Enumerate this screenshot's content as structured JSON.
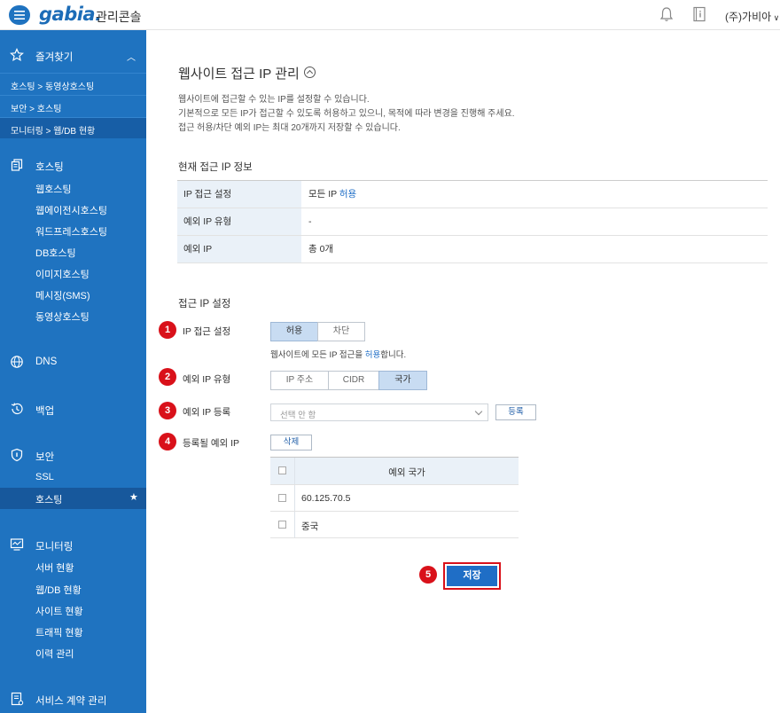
{
  "header": {
    "logo": "gabia.",
    "console_title": "관리콘솔",
    "company": "(주)가비아"
  },
  "sidebar": {
    "favorites": {
      "label": "즐겨찾기",
      "items": [
        "호스팅 > 동영상호스팅",
        "보안 > 호스팅",
        "모니터링 > 웹/DB 현황"
      ]
    },
    "hosting": {
      "label": "호스팅",
      "items": [
        "웹호스팅",
        "웹에이전시호스팅",
        "워드프레스호스팅",
        "DB호스팅",
        "이미지호스팅",
        "메시징(SMS)",
        "동영상호스팅"
      ]
    },
    "dns": {
      "label": "DNS"
    },
    "backup": {
      "label": "백업"
    },
    "security": {
      "label": "보안",
      "items": [
        "SSL"
      ],
      "active_item": "호스팅"
    },
    "monitoring": {
      "label": "모니터링",
      "items": [
        "서버 현황",
        "웹/DB 현황",
        "사이트 현황",
        "트래픽 현황",
        "이력 관리"
      ]
    },
    "contract": {
      "label": "서비스 계약 관리"
    }
  },
  "main": {
    "title": "웹사이트 접근 IP 관리",
    "description": [
      "웹사이트에 접근할 수 있는 IP를 설정할 수 있습니다.",
      "기본적으로 모든 IP가 접근할 수 있도록 허용하고 있으니, 목적에 따라 변경을 진행해 주세요.",
      "접근 허용/차단 예외 IP는 최대 20개까지 저장할 수 있습니다."
    ],
    "current_info": {
      "title": "현재 접근 IP 정보",
      "rows": [
        {
          "key": "IP 접근 설정",
          "value_prefix": "모든 IP ",
          "value_highlight": "허용"
        },
        {
          "key": "예외 IP 유형",
          "value_prefix": "-",
          "value_highlight": ""
        },
        {
          "key": "예외 IP",
          "value_prefix": "총 0개",
          "value_highlight": ""
        }
      ]
    },
    "settings": {
      "title": "접근 IP 설정",
      "steps": [
        "1",
        "2",
        "3",
        "4",
        "5"
      ],
      "access_label": "IP 접근 설정",
      "access_options": [
        "허용",
        "차단"
      ],
      "access_selected": "허용",
      "access_hint_prefix": "웹사이트에 모든 IP 접근을 ",
      "access_hint_highlight": "허용",
      "access_hint_suffix": "합니다.",
      "type_label": "예외 IP 유형",
      "type_options": [
        "IP 주소",
        "CIDR",
        "국가"
      ],
      "type_selected": "국가",
      "register_label": "예외 IP 등록",
      "register_placeholder": "선택 안 함",
      "register_button": "등록",
      "registered_label": "등록될 예외 IP",
      "delete_button": "삭제",
      "table_header": "예외 국가",
      "table_rows": [
        "60.125.70.5",
        "중국"
      ],
      "save_button": "저장"
    }
  },
  "colors": {
    "brand": "#1f73c0",
    "highlight": "#d9111a",
    "selected_seg": "#c8dcf2"
  }
}
